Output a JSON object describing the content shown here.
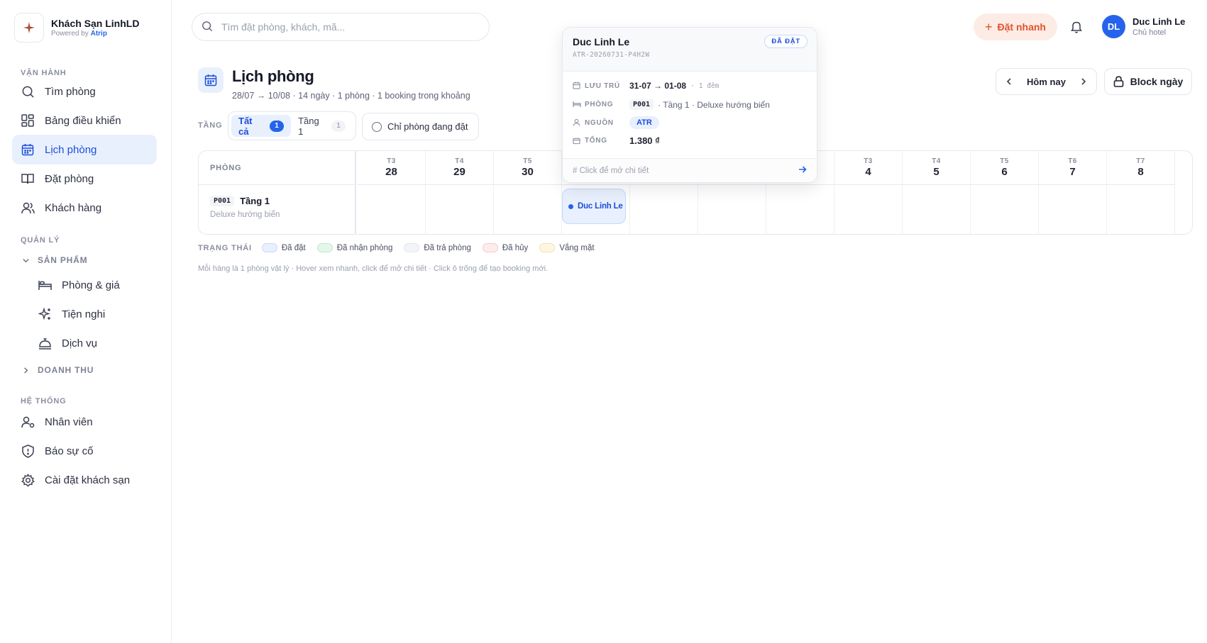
{
  "brand": {
    "name": "Khách Sạn LinhLD",
    "powered_prefix": "Powered by",
    "powered_brand": "Atrip"
  },
  "search": {
    "placeholder": "Tìm đặt phòng, khách, mã..."
  },
  "header": {
    "quick_book": "Đặt nhanh",
    "user_initials": "DL",
    "user_name": "Duc Linh Le",
    "user_role": "Chủ hotel"
  },
  "sidebar": {
    "sections": {
      "operations": "VẬN HÀNH",
      "management": "QUẢN LÝ",
      "system": "HỆ THỐNG"
    },
    "items": {
      "find_room": "Tìm phòng",
      "dashboard": "Bảng điều khiển",
      "calendar": "Lịch phòng",
      "booking": "Đặt phòng",
      "customers": "Khách hàng",
      "products": "SẢN PHẨM",
      "rooms_prices": "Phòng & giá",
      "amenities": "Tiện nghi",
      "services": "Dịch vụ",
      "revenue": "DOANH THU",
      "staff": "Nhân viên",
      "incident": "Báo sự cố",
      "settings": "Cài đặt khách sạn"
    }
  },
  "page": {
    "title": "Lịch phòng",
    "subtitle": "28/07 → 10/08 · 14 ngày · 1 phòng · 1 booking trong khoảng",
    "today_label": "Hôm nay",
    "block_label": "Block ngày"
  },
  "filters": {
    "floor_label": "TẦNG",
    "all_label": "Tất cả",
    "all_count": "1",
    "floor1_label": "Tầng 1",
    "floor1_count": "1",
    "only_booked": "Chỉ phòng đang đặt"
  },
  "grid": {
    "room_header": "PHÒNG",
    "days": [
      {
        "dow": "T3",
        "day": "28"
      },
      {
        "dow": "T4",
        "day": "29"
      },
      {
        "dow": "T5",
        "day": "30"
      },
      {
        "dow": "",
        "day": ""
      },
      {
        "dow": "",
        "day": ""
      },
      {
        "dow": "",
        "day": ""
      },
      {
        "dow": "",
        "day": ""
      },
      {
        "dow": "T3",
        "day": "4"
      },
      {
        "dow": "T4",
        "day": "5"
      },
      {
        "dow": "T5",
        "day": "6"
      },
      {
        "dow": "T6",
        "day": "7"
      },
      {
        "dow": "T7",
        "day": "8"
      }
    ],
    "room": {
      "code": "P001",
      "floor": "Tầng 1",
      "type": "Deluxe hướng biển"
    },
    "booking_name": "Duc Linh Le"
  },
  "legend": {
    "title": "TRẠNG THÁI",
    "items": [
      {
        "label": "Đã đặt",
        "fill": "#e8f0fe",
        "border": "#c7d8fb"
      },
      {
        "label": "Đã nhận phòng",
        "fill": "#e3f7ea",
        "border": "#bfe9cc"
      },
      {
        "label": "Đã trả phòng",
        "fill": "#f3f4f7",
        "border": "#e3e6ec"
      },
      {
        "label": "Đã hủy",
        "fill": "#fdecec",
        "border": "#f7c9c9"
      },
      {
        "label": "Vắng mặt",
        "fill": "#fdf6e3",
        "border": "#f3e2ad"
      }
    ]
  },
  "hint": "Mỗi hàng là 1 phòng vật lý · Hover xem nhanh, click để mở chi tiết · Click ô trống để tạo booking mới.",
  "popover": {
    "guest": "Duc Linh Le",
    "code": "ATR-20260731-P4H2W",
    "status": "ĐÃ ĐẶT",
    "stay_label": "LƯU TRÚ",
    "stay_value": "31-07 → 01-08",
    "stay_nights": "1 đêm",
    "room_label": "PHÒNG",
    "room_code": "P001",
    "room_desc": "· Tầng 1 · Deluxe hướng biển",
    "source_label": "NGUỒN",
    "source_value": "ATR",
    "total_label": "TỔNG",
    "total_value": "1.380 ₫",
    "footer": "Click để mở chi tiết"
  },
  "colors": {
    "accent": "#2563eb",
    "accent_soft": "#e8f0fe",
    "quick": "#e0532b"
  }
}
